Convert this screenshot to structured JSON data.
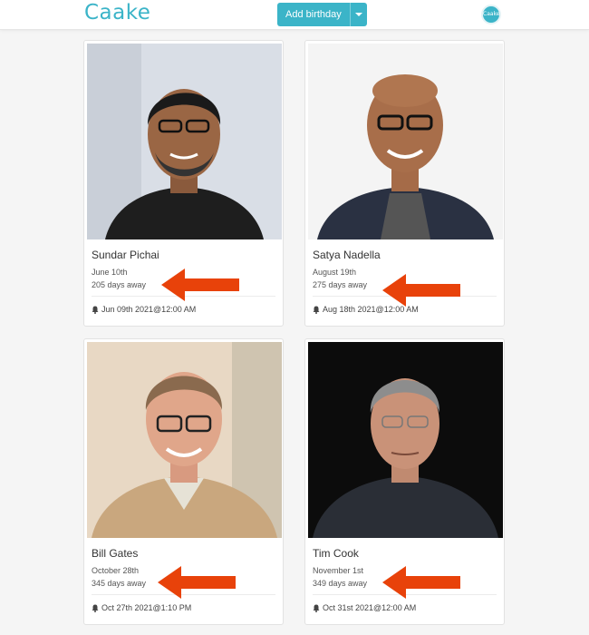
{
  "app": {
    "brand": "Caake",
    "add_button": "Add birthday",
    "avatar_text": "Caake"
  },
  "colors": {
    "accent": "#3bb4c8",
    "annotation_arrow": "#e8420a"
  },
  "cards": [
    {
      "name": "Sundar Pichai",
      "date": "June 10th",
      "away": "205 days away",
      "reminder": "Jun 09th 2021@12:00 AM",
      "photo": "portrait-photo"
    },
    {
      "name": "Satya Nadella",
      "date": "August 19th",
      "away": "275 days away",
      "reminder": "Aug 18th 2021@12:00 AM",
      "photo": "portrait-photo"
    },
    {
      "name": "Bill Gates",
      "date": "October 28th",
      "away": "345 days away",
      "reminder": "Oct 27th 2021@1:10 PM",
      "photo": "portrait-photo"
    },
    {
      "name": "Tim Cook",
      "date": "November 1st",
      "away": "349 days away",
      "reminder": "Oct 31st 2021@12:00 AM",
      "photo": "portrait-photo"
    }
  ],
  "icons": {
    "reminder": "bell-icon",
    "dropdown": "caret-down-icon",
    "annotation": "arrow-left-icon"
  }
}
